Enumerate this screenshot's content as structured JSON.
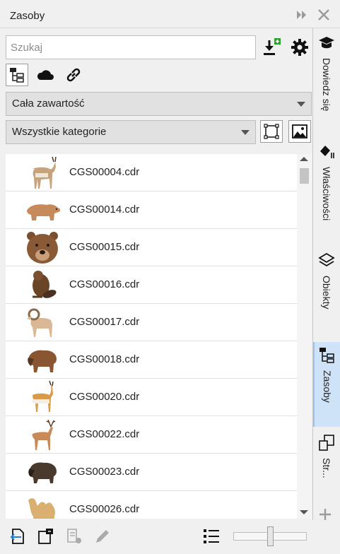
{
  "window": {
    "title": "Zasoby"
  },
  "search": {
    "placeholder": "Szukaj",
    "value": ""
  },
  "filters": {
    "content_scope": "Cała zawartość",
    "category": "Wszystkie kategorie"
  },
  "list": {
    "items": [
      {
        "name": "CGS00004.cdr",
        "thumb": "antelope"
      },
      {
        "name": "CGS00014.cdr",
        "thumb": "bear"
      },
      {
        "name": "CGS00015.cdr",
        "thumb": "bear-head"
      },
      {
        "name": "CGS00016.cdr",
        "thumb": "beaver"
      },
      {
        "name": "CGS00017.cdr",
        "thumb": "bighorn-sheep"
      },
      {
        "name": "CGS00018.cdr",
        "thumb": "bison"
      },
      {
        "name": "CGS00020.cdr",
        "thumb": "springbok"
      },
      {
        "name": "CGS00022.cdr",
        "thumb": "deer"
      },
      {
        "name": "CGS00023.cdr",
        "thumb": "bison-dark"
      },
      {
        "name": "CGS00026.cdr",
        "thumb": "camel"
      }
    ]
  },
  "side_tabs": [
    {
      "label": "Dowiedz się",
      "icon": "graduation-cap-icon"
    },
    {
      "label": "Właściwości",
      "icon": "properties-icon"
    },
    {
      "label": "Obiekty",
      "icon": "layers-icon"
    },
    {
      "label": "Zasoby",
      "icon": "assets-icon",
      "active": true
    },
    {
      "label": "Str...",
      "icon": "pages-icon"
    }
  ],
  "colors": {
    "accent": "#cfe3f8",
    "import_badge": "#2aa12a"
  }
}
